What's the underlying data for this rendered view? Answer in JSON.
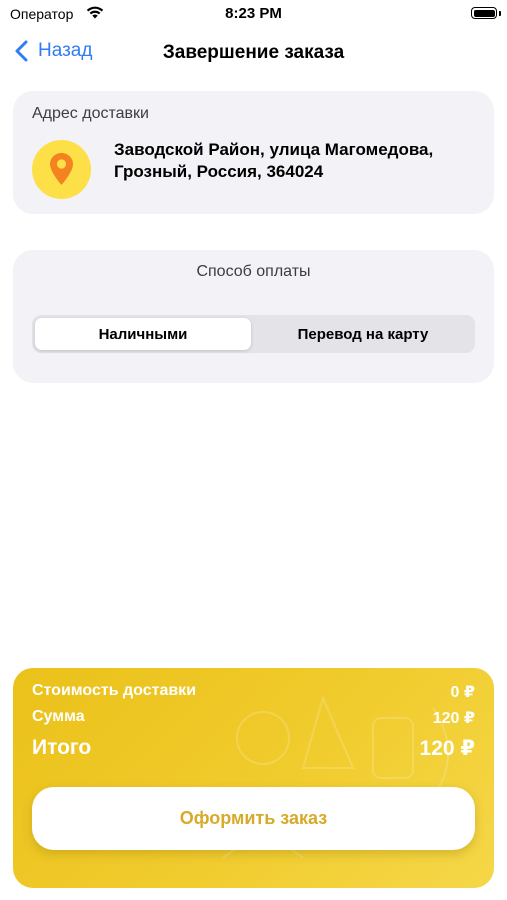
{
  "status_bar": {
    "carrier": "Оператор",
    "time": "8:23 PM"
  },
  "nav": {
    "back_label": "Назад",
    "title": "Завершение заказа"
  },
  "address": {
    "heading": "Адрес доставки",
    "text": "Заводской Район, улица Магомедова, Грозный, Россия, 364024",
    "icon": "location-pin-icon"
  },
  "payment": {
    "heading": "Способ оплаты",
    "options": [
      "Наличными",
      "Перевод на карту"
    ],
    "selected": "Наличными"
  },
  "summary": {
    "delivery_label": "Стоимость доставки",
    "delivery_value": "0 ₽",
    "sum_label": "Сумма",
    "sum_value": "120 ₽",
    "total_label": "Итого",
    "total_value": "120 ₽",
    "order_button": "Оформить заказ"
  },
  "colors": {
    "accent_blue": "#2f7cf6",
    "yellow": "#f1cc2e",
    "pin_orange": "#f58220",
    "card_bg": "#f2f2f7"
  }
}
